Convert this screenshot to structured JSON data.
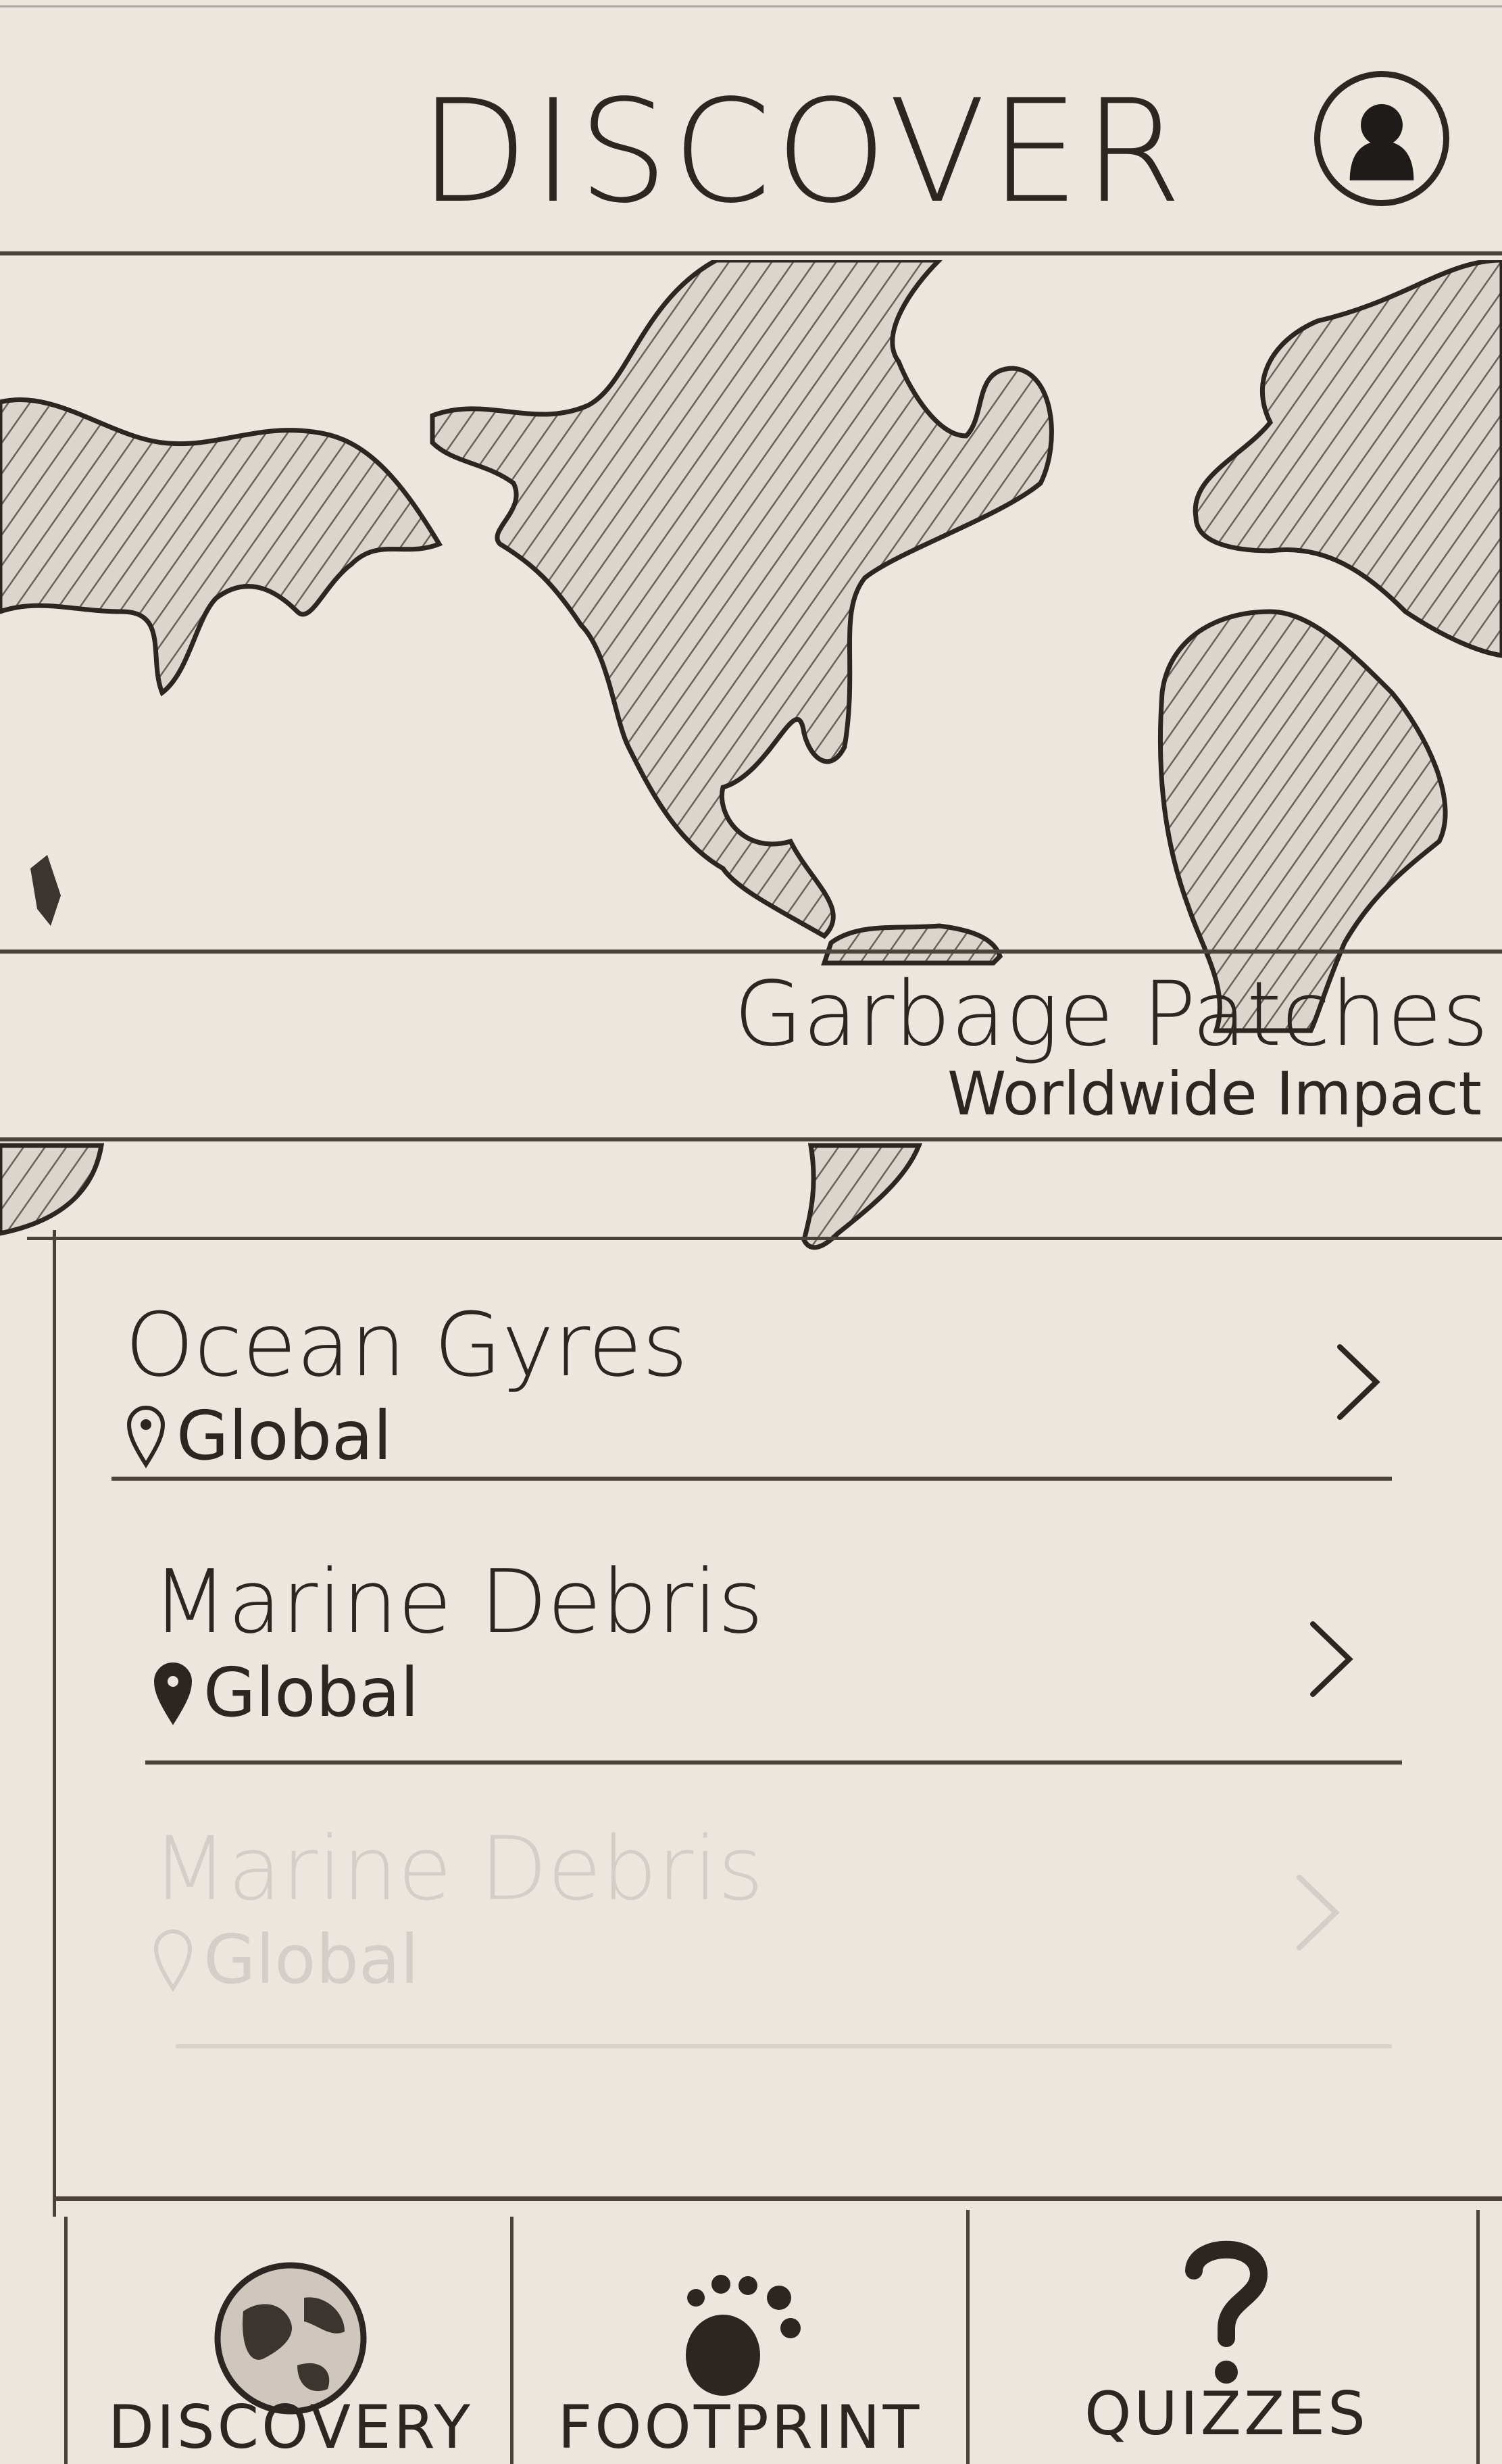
{
  "header": {
    "title": "DISCOVER",
    "profile_icon": "user-avatar-icon"
  },
  "map": {
    "icon": "world-map"
  },
  "banner": {
    "title": "Garbage Patches",
    "subtitle": "Worldwide Impact"
  },
  "list": {
    "items": [
      {
        "title": "Ocean Gyres",
        "location": "Global",
        "location_icon": "location-pin-icon",
        "action_icon": "chevron-right-icon"
      },
      {
        "title": "Marine Debris",
        "location": "Global",
        "location_icon": "location-pin-icon",
        "action_icon": "chevron-right-icon"
      },
      {
        "title": "Marine Debris",
        "location": "Global",
        "location_icon": "location-pin-icon",
        "action_icon": "chevron-right-icon"
      }
    ]
  },
  "tab_bar": {
    "tabs": [
      {
        "label": "DISCOVERY",
        "icon": "globe-icon",
        "selected": true
      },
      {
        "label": "FOOTPRINT",
        "icon": "footprint-icon",
        "selected": false
      },
      {
        "label": "QUIZZES",
        "icon": "question-mark-icon",
        "selected": false
      }
    ]
  }
}
